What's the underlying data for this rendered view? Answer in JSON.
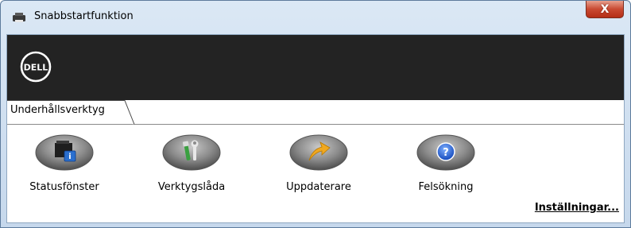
{
  "window": {
    "title": "Snabbstartfunktion",
    "close_label": "X"
  },
  "banner": {
    "logo_text": "DELL"
  },
  "tabs": [
    {
      "label": "Underhållsverktyg",
      "selected": true
    }
  ],
  "tools": [
    {
      "label": "Statusfönster",
      "icon": "printer-status-icon"
    },
    {
      "label": "Verktygslåda",
      "icon": "toolbox-icon"
    },
    {
      "label": "Uppdaterare",
      "icon": "update-arrow-icon"
    },
    {
      "label": "Felsökning",
      "icon": "help-icon"
    }
  ],
  "settings_link": "Inställningar...",
  "colors": {
    "banner": "#232323",
    "close_button": "#c94a32",
    "update_arrow": "#f0a820",
    "help_blue": "#2a5fd0",
    "wrench_green": "#3aa040"
  }
}
